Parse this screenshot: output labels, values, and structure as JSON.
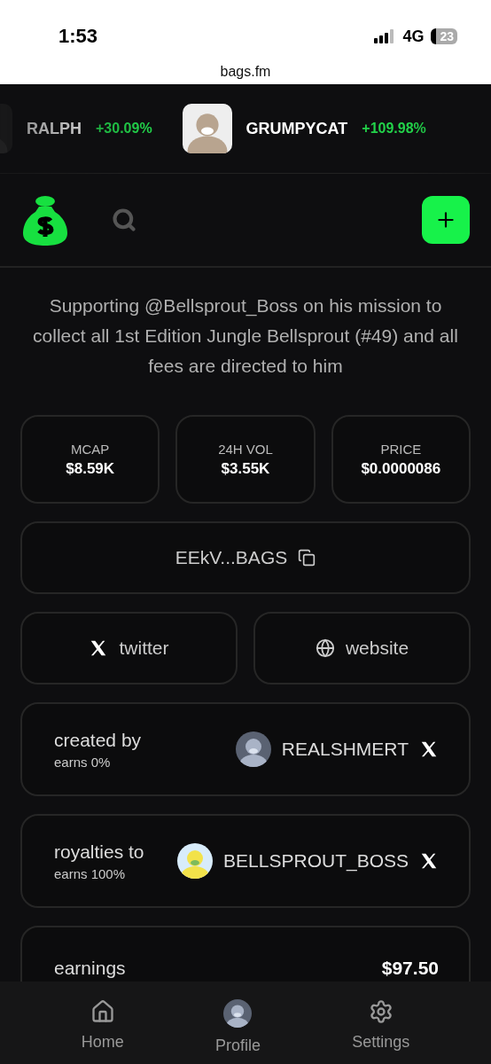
{
  "status_bar": {
    "time": "1:53",
    "network": "4G",
    "battery": "23"
  },
  "browser": {
    "url": "bags.fm"
  },
  "ticker": [
    {
      "name": "RALPH",
      "change": "+30.09%"
    },
    {
      "name": "GRUMPYCAT",
      "change": "+109.98%"
    }
  ],
  "description": "Supporting @Bellsprout_Boss on his mission to collect all 1st Edition Jungle Bellsprout (#49) and all fees are directed to him",
  "stats": [
    {
      "label": "MCAP",
      "value": "$8.59K"
    },
    {
      "label": "24H VOL",
      "value": "$3.55K"
    },
    {
      "label": "PRICE",
      "value": "$0.0000086"
    }
  ],
  "address": "EEkV...BAGS",
  "links": [
    {
      "kind": "x",
      "label": "twitter"
    },
    {
      "kind": "globe",
      "label": "website"
    }
  ],
  "people": [
    {
      "title": "created by",
      "earns": "earns 0%",
      "name": "REALSHMERT"
    },
    {
      "title": "royalties to",
      "earns": "earns 100%",
      "name": "BELLSPROUT_BOSS"
    }
  ],
  "earnings": {
    "label": "earnings",
    "value": "$97.50"
  },
  "nav": [
    {
      "kind": "home",
      "label": "Home"
    },
    {
      "kind": "avatar",
      "label": "Profile"
    },
    {
      "kind": "settings",
      "label": "Settings"
    }
  ]
}
